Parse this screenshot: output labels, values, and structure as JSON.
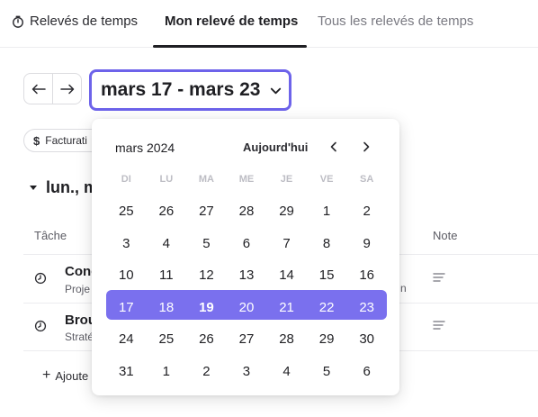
{
  "header": {
    "app_title": "Relevés de temps",
    "tabs": [
      {
        "label": "Mon relevé de temps",
        "active": true
      },
      {
        "label": "Tous les relevés de temps",
        "active": false
      }
    ]
  },
  "week_nav": {
    "prev_icon": "arrow-left-icon",
    "next_icon": "arrow-right-icon",
    "range_label": "mars 17 - mars 23"
  },
  "filters": {
    "chip_label": "Facturati"
  },
  "day_section": {
    "label": "lun., m"
  },
  "table": {
    "columns": {
      "task": "Tâche",
      "note": "Note"
    },
    "rows": [
      {
        "title": "Conc",
        "subtitle": "Proje",
        "trailing": "n"
      },
      {
        "title": "Brou",
        "subtitle": "Straté",
        "trailing": ""
      }
    ],
    "add_label": "Ajoute"
  },
  "calendar": {
    "month_label": "mars 2024",
    "today_label": "Aujourd'hui",
    "weekdays": [
      "DI",
      "LU",
      "MA",
      "ME",
      "JE",
      "VE",
      "SA"
    ],
    "weeks": [
      [
        "25",
        "26",
        "27",
        "28",
        "29",
        "1",
        "2"
      ],
      [
        "3",
        "4",
        "5",
        "6",
        "7",
        "8",
        "9"
      ],
      [
        "10",
        "11",
        "12",
        "13",
        "14",
        "15",
        "16"
      ],
      [
        "17",
        "18",
        "19",
        "20",
        "21",
        "22",
        "23"
      ],
      [
        "24",
        "25",
        "26",
        "27",
        "28",
        "29",
        "30"
      ],
      [
        "31",
        "1",
        "2",
        "3",
        "4",
        "5",
        "6"
      ]
    ],
    "selected_week_index": 3,
    "today_day": "19",
    "accent_color": "#7a70ee",
    "focus_color": "#6d63ea"
  }
}
